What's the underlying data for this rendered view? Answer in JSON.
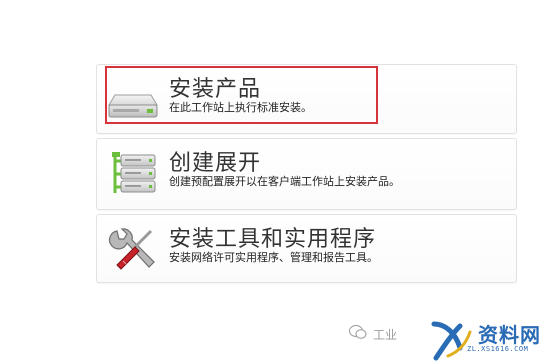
{
  "options": [
    {
      "title": "安装产品",
      "description": "在此工作站上执行标准安装。",
      "icon": "hard-drive-icon"
    },
    {
      "title": "创建展开",
      "description": "创建预配置展开以在客户端工作站上安装产品。",
      "icon": "server-deploy-icon"
    },
    {
      "title": "安装工具和实用程序",
      "description": "安装网络许可实用程序、管理和报告工具。",
      "icon": "tools-icon"
    }
  ],
  "highlight_color": "#d6333a",
  "watermark": {
    "text": "工业",
    "logo_text": "资料网",
    "logo_url_text": "ZL.XS1616.COM"
  }
}
